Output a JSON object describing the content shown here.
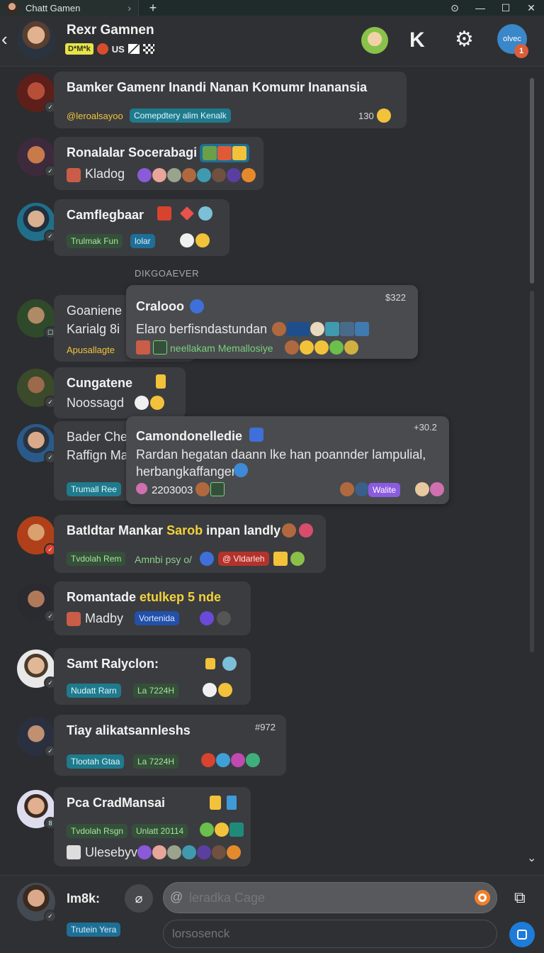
{
  "titlebar": {
    "tab_title": "Chatt Gamen",
    "chevron": "›",
    "new_tab": "+",
    "btn_history": "⊙",
    "btn_min": "—",
    "btn_max": "☐",
    "btn_close": "✕"
  },
  "header": {
    "back": "‹",
    "name": "Rexr Gamnen",
    "tag": "D*M*k",
    "country": "US",
    "user_label": "olvec",
    "user_count": "1"
  },
  "separator": "DIKGOAEVER",
  "messages": [
    {
      "name": "Bamker Gamenr Inandi Nanan Komumr Inanansia",
      "mention": "@leroalsayoo",
      "pill": "Comepdtery alim Kenalk",
      "time": "130"
    },
    {
      "name": "Ronalalar Socerabagi",
      "text": "Kladog"
    },
    {
      "name": "Camflegbaar",
      "pill1": "Trulmak Fun",
      "pill2": "lolar"
    },
    {
      "name": "Goaniene",
      "text": "Karialg 8i",
      "mention": "Apusallagte"
    },
    {
      "name": "Cungatene",
      "text": "Noossagd"
    },
    {
      "name": "Bader Che",
      "text": "Raffign Ma",
      "pill": "Trumall Ree"
    },
    {
      "name": "Batldtar Mankar",
      "name_hl": "Sarob",
      "name_rest": "inpan landly",
      "pill1": "Tvdolah Rem",
      "text": "Amnbi psy o/",
      "pill2": "@ Vldarleh"
    },
    {
      "name": "Romantade",
      "name_hl": "etulkep 5 nde",
      "text": "Madby",
      "pill": "Vortenida"
    },
    {
      "name": "Samt Ralyclon:",
      "pill1": "Nudatt Rarn",
      "pill2": "La 7224H"
    },
    {
      "name": "Tiay alikatsannleshs",
      "time": "#972",
      "pill1": "Tlootah Gtaa",
      "pill2": "La 7224H"
    },
    {
      "name": "Pca CradMansai",
      "pill1": "Tvdolah Rsgn",
      "pill2": "Unlatt 20114",
      "text": "Ulesebyv"
    }
  ],
  "floating": [
    {
      "title": "Cralooo",
      "time": "$322",
      "text": "Elaro berfisndastundan",
      "greentext": "neellakam Memallosiye"
    },
    {
      "title": "Camondonelledie",
      "time": "+30.2",
      "text1": "Rardan hegatan daann lke han poannder lampulial,",
      "text2": "herbangkaffanger",
      "count": "2203003",
      "pill": "Walite"
    }
  ],
  "composer": {
    "label": "Im8k:",
    "pill": "Trutein Yera",
    "input_placeholder": "leradka Cage",
    "input2_placeholder": "lorsosenck",
    "at": "@",
    "copy_icon": "⧉"
  },
  "colors": {
    "accent": "#1e7bd8",
    "highlight": "#f2d23a",
    "green": "#79d27a",
    "record": "#ef7f2c"
  }
}
